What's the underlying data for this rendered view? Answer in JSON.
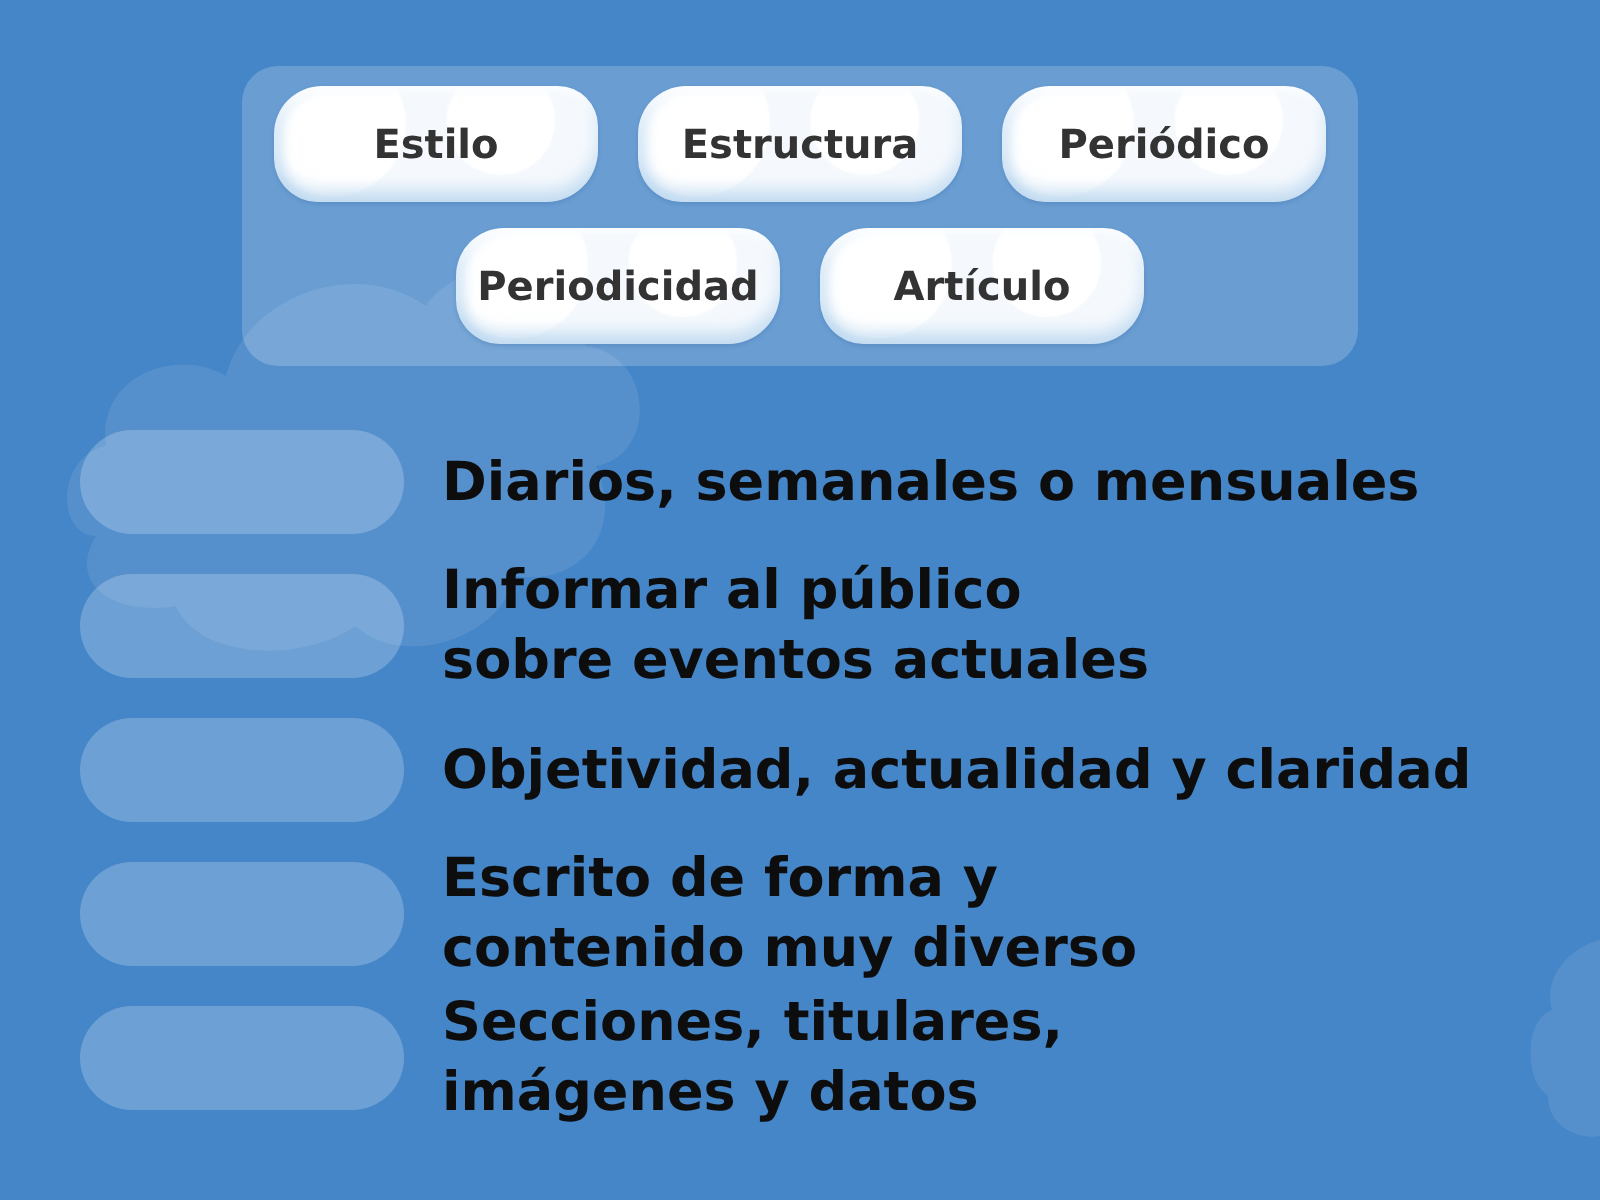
{
  "word_bank": {
    "tiles": [
      {
        "label": "Estilo"
      },
      {
        "label": "Estructura"
      },
      {
        "label": "Periódico"
      },
      {
        "label": "Periodicidad"
      },
      {
        "label": "Artículo"
      }
    ]
  },
  "match_rows": [
    {
      "description": "Diarios, semanales o mensuales"
    },
    {
      "description": "Informar al público\nsobre eventos actuales"
    },
    {
      "description": "Objetividad, actualidad y claridad"
    },
    {
      "description": "Escrito de forma y\ncontenido muy diverso"
    },
    {
      "description": "Secciones, titulares,\nimágenes y datos"
    }
  ]
}
